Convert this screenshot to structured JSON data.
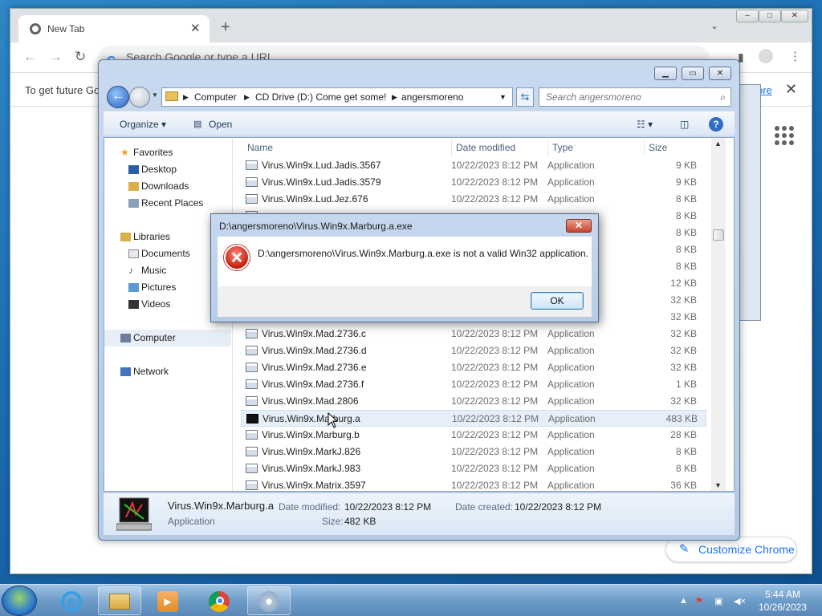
{
  "chrome": {
    "tab_title": "New Tab",
    "tab_close": "✕",
    "new_tab": "+",
    "omnibox_placeholder": "Search Google or type a URL",
    "infobar_text": "To get future Go",
    "infobar_link": "ore",
    "infobar_close": "✕",
    "customize_label": "Customize Chrome",
    "window_min": "–",
    "window_max": "□",
    "window_close": "✕"
  },
  "explorer": {
    "breadcrumb": [
      "Computer",
      "CD Drive (D:) Come get some!",
      "angersmoreno"
    ],
    "search_placeholder": "Search angersmoreno",
    "toolbar": {
      "organize": "Organize ▾",
      "open": "Open"
    },
    "nav": {
      "favorites": "Favorites",
      "desktop": "Desktop",
      "downloads": "Downloads",
      "recent": "Recent Places",
      "libraries": "Libraries",
      "documents": "Documents",
      "music": "Music",
      "pictures": "Pictures",
      "videos": "Videos",
      "computer": "Computer",
      "network": "Network"
    },
    "columns": {
      "name": "Name",
      "date": "Date modified",
      "type": "Type",
      "size": "Size"
    },
    "files": [
      {
        "name": "Virus.Win9x.Lud.Jadis.3567",
        "date": "10/22/2023 8:12 PM",
        "type": "Application",
        "size": "9 KB"
      },
      {
        "name": "Virus.Win9x.Lud.Jadis.3579",
        "date": "10/22/2023 8:12 PM",
        "type": "Application",
        "size": "9 KB"
      },
      {
        "name": "Virus.Win9x.Lud.Jez.676",
        "date": "10/22/2023 8:12 PM",
        "type": "Application",
        "size": "8 KB"
      },
      {
        "name": "",
        "date": "",
        "type": "",
        "size": "8 KB"
      },
      {
        "name": "",
        "date": "",
        "type": "",
        "size": "8 KB"
      },
      {
        "name": "",
        "date": "",
        "type": "",
        "size": "8 KB"
      },
      {
        "name": "",
        "date": "",
        "type": "",
        "size": "8 KB"
      },
      {
        "name": "",
        "date": "",
        "type": "",
        "size": "12 KB"
      },
      {
        "name": "",
        "date": "",
        "type": "",
        "size": "32 KB"
      },
      {
        "name": "",
        "date": "",
        "type": "",
        "size": "32 KB"
      },
      {
        "name": "Virus.Win9x.Mad.2736.c",
        "date": "10/22/2023 8:12 PM",
        "type": "Application",
        "size": "32 KB"
      },
      {
        "name": "Virus.Win9x.Mad.2736.d",
        "date": "10/22/2023 8:12 PM",
        "type": "Application",
        "size": "32 KB"
      },
      {
        "name": "Virus.Win9x.Mad.2736.e",
        "date": "10/22/2023 8:12 PM",
        "type": "Application",
        "size": "32 KB"
      },
      {
        "name": "Virus.Win9x.Mad.2736.f",
        "date": "10/22/2023 8:12 PM",
        "type": "Application",
        "size": "1 KB"
      },
      {
        "name": "Virus.Win9x.Mad.2806",
        "date": "10/22/2023 8:12 PM",
        "type": "Application",
        "size": "32 KB"
      },
      {
        "name": "Virus.Win9x.Marburg.a",
        "date": "10/22/2023 8:12 PM",
        "type": "Application",
        "size": "483 KB"
      },
      {
        "name": "Virus.Win9x.Marburg.b",
        "date": "10/22/2023 8:12 PM",
        "type": "Application",
        "size": "28 KB"
      },
      {
        "name": "Virus.Win9x.MarkJ.826",
        "date": "10/22/2023 8:12 PM",
        "type": "Application",
        "size": "8 KB"
      },
      {
        "name": "Virus.Win9x.MarkJ.983",
        "date": "10/22/2023 8:12 PM",
        "type": "Application",
        "size": "8 KB"
      },
      {
        "name": "Virus.Win9x.Matrix.3597",
        "date": "10/22/2023 8:12 PM",
        "type": "Application",
        "size": "36 KB"
      }
    ],
    "details": {
      "name": "Virus.Win9x.Marburg.a",
      "type": "Application",
      "modified_label": "Date modified:",
      "modified": "10/22/2023 8:12 PM",
      "created_label": "Date created:",
      "created": "10/22/2023 8:12 PM",
      "size_label": "Size:",
      "size": "482 KB"
    }
  },
  "dialog": {
    "title": "D:\\angersmoreno\\Virus.Win9x.Marburg.a.exe",
    "message": "D:\\angersmoreno\\Virus.Win9x.Marburg.a.exe is not a valid Win32 application.",
    "ok": "OK",
    "close": "✕"
  },
  "taskbar": {
    "time": "5:44 AM",
    "date": "10/26/2023"
  },
  "colors": {
    "accent": "#1a73e8",
    "error": "#c81c0c",
    "taskbar": "#6d9cc9"
  }
}
